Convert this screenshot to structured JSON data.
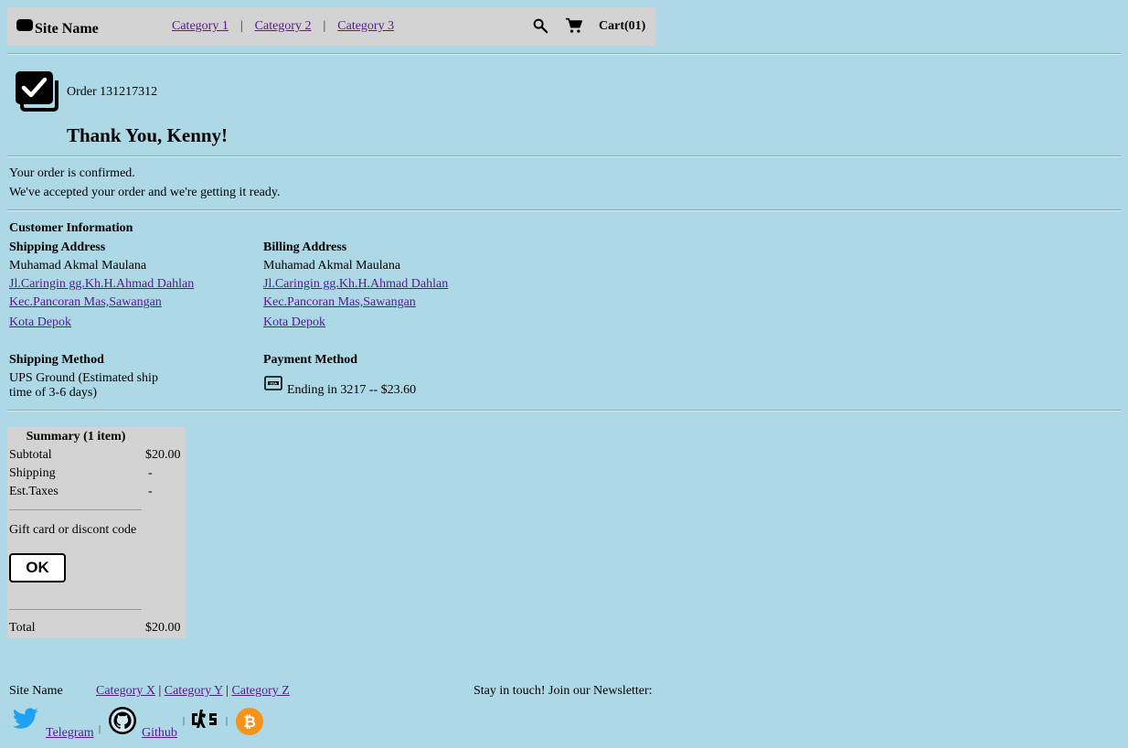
{
  "header": {
    "site_name": "Site Name",
    "nav": [
      "Category 1",
      "Category 2",
      "Category 3"
    ],
    "separator": "|",
    "cart_label": "Cart(01)"
  },
  "order": {
    "number": "Order 131217312",
    "thanks": "Thank You, Kenny!",
    "confirm_line1": "Your order is confirmed.",
    "confirm_line2": "We've accepted your order and we're getting it ready."
  },
  "customer": {
    "title": "Customer Information",
    "shipping_address": {
      "heading": "Shipping Address",
      "name": "Muhamad Akmal Maulana",
      "lines": [
        "Jl.Caringin gg.Kh.H.Ahmad Dahlan",
        "Kec.Pancoran Mas,Sawangan",
        "Kota Depok"
      ]
    },
    "billing_address": {
      "heading": "Billing Address",
      "name": "Muhamad Akmal Maulana",
      "lines": [
        "Jl.Caringin gg.Kh.H.Ahmad Dahlan",
        "Kec.Pancoran Mas,Sawangan",
        "Kota Depok"
      ]
    },
    "shipping_method": {
      "heading": "Shipping Method",
      "value": "UPS Ground (Estimated ship time of 3-6 days)"
    },
    "payment_method": {
      "heading": "Payment Method",
      "card_icon": "visa-card-icon",
      "value": "Ending in 3217 -- $23.60"
    }
  },
  "summary": {
    "title": "Summary (1 item)",
    "subtotal_label": "Subtotal",
    "subtotal_value": "$20.00",
    "shipping_label": "Shipping",
    "shipping_value": "-",
    "taxes_label": "Est.Taxes",
    "taxes_value": "-",
    "gift_label": "Gift card or discont code",
    "ok_label": "OK",
    "total_label": "Total",
    "total_value": "$20.00"
  },
  "footer": {
    "site_name": "Site Name",
    "categories": [
      "Category X",
      "Category Y",
      "Category Z"
    ],
    "newsletter": "Stay in touch! Join our Newsletter:",
    "telegram": "Telegram",
    "github": "Github",
    "separator": "|"
  },
  "colors": {
    "background": "#add8e6",
    "panel": "#d3d3d3",
    "link": "#551a8b",
    "twitter": "#1da1f2",
    "bitcoin": "#f7931a"
  }
}
